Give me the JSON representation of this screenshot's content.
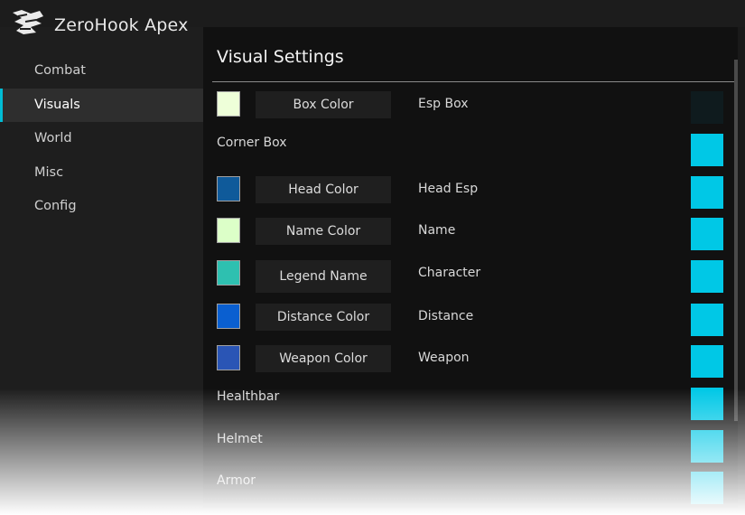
{
  "app": {
    "title": "ZeroHook Apex"
  },
  "sidebar": {
    "items": [
      {
        "label": "Combat",
        "active": false
      },
      {
        "label": "Visuals",
        "active": true
      },
      {
        "label": "World",
        "active": false
      },
      {
        "label": "Misc",
        "active": false
      },
      {
        "label": "Config",
        "active": false
      }
    ]
  },
  "main": {
    "title": "Visual Settings",
    "rows": [
      {
        "swatch_color": "#eeffd9",
        "button": "Box Color",
        "label": "Esp Box",
        "toggle_on": false
      },
      {
        "label": "Corner Box",
        "toggle_on": true
      },
      {
        "swatch_color": "#0f5a9a",
        "button": "Head Color",
        "label": "Head Esp",
        "toggle_on": true
      },
      {
        "swatch_color": "#dcffc8",
        "button": "Name Color",
        "label": "Name",
        "toggle_on": true
      },
      {
        "swatch_color": "#2ec0b0",
        "button": "Legend Name",
        "label": "Character",
        "toggle_on": true
      },
      {
        "swatch_color": "#0a5fd0",
        "button": "Distance Color",
        "label": "Distance",
        "toggle_on": true
      },
      {
        "swatch_color": "#2a55b5",
        "button": "Weapon Color",
        "label": "Weapon",
        "toggle_on": true
      },
      {
        "label": "Healthbar",
        "toggle_on": true
      },
      {
        "label": "Helmet",
        "toggle_on": true
      },
      {
        "label": "Armor",
        "toggle_on": true
      }
    ]
  },
  "colors": {
    "accent": "#00c8e6",
    "toggle_off": "#0f1b1e",
    "background": "#111111",
    "sidebar_bg": "#1e1e1e"
  }
}
